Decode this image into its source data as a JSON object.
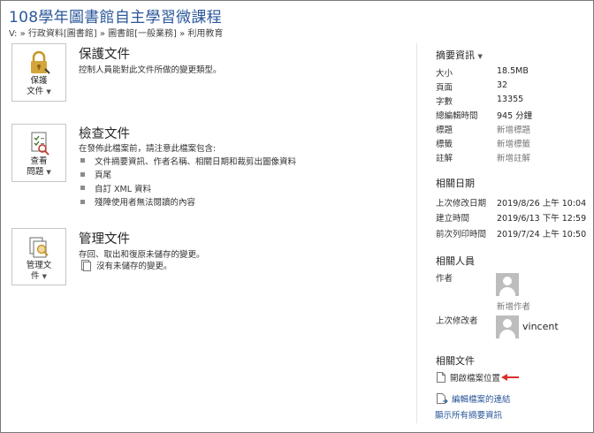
{
  "document": {
    "title": "108學年圖書館自主學習微課程",
    "path": "V: » 行政資料[圖書館] » 圖書館[一般業務] » 利用教育"
  },
  "protect": {
    "tile_label_line1": "保護",
    "tile_label_line2": "文件",
    "title": "保護文件",
    "description": "控制人員能對此文件所做的變更類型。"
  },
  "inspect": {
    "tile_label_line1": "查看",
    "tile_label_line2": "問題",
    "title": "檢查文件",
    "description": "在發佈此檔案前，請注意此檔案包含:",
    "items": [
      "文件摘要資訊、作者名稱、相關日期和裁剪出圖像資料",
      "頁尾",
      "自訂 XML 資料",
      "殘障使用者無法閱讀的內容"
    ]
  },
  "manage": {
    "tile_label_line1": "管理文",
    "tile_label_line2": "件",
    "title": "管理文件",
    "description": "存回、取出和復原未儲存的變更。",
    "item": "沒有未儲存的變更。"
  },
  "properties": {
    "heading": "摘要資訊",
    "rows": [
      {
        "label": "大小",
        "value": "18.5MB",
        "placeholder": false
      },
      {
        "label": "頁面",
        "value": "32",
        "placeholder": false
      },
      {
        "label": "字數",
        "value": "13355",
        "placeholder": false
      },
      {
        "label": "總編輯時間",
        "value": "945 分鐘",
        "placeholder": false
      },
      {
        "label": "標題",
        "value": "新增標題",
        "placeholder": true
      },
      {
        "label": "標籤",
        "value": "新增標籤",
        "placeholder": true
      },
      {
        "label": "註解",
        "value": "新增註解",
        "placeholder": true
      }
    ]
  },
  "dates": {
    "heading": "相關日期",
    "rows": [
      {
        "label": "上次修改日期",
        "value": "2019/8/26 上午 10:04"
      },
      {
        "label": "建立時間",
        "value": "2019/6/13 下午 12:59"
      },
      {
        "label": "前次列印時間",
        "value": "2019/7/24 上午 10:50"
      }
    ]
  },
  "people": {
    "heading": "相關人員",
    "author_label": "作者",
    "add_author": "新增作者",
    "last_modified_label": "上次修改者",
    "last_modified_name": "vincent"
  },
  "related_docs": {
    "heading": "相關文件",
    "open_location": "開啟檔案位置",
    "edit_links": "編輯檔案的連結",
    "show_all": "顯示所有摘要資訊"
  },
  "colors": {
    "accent": "#2b579a",
    "arrow": "#d9302c",
    "lock": "#d4a53a"
  }
}
